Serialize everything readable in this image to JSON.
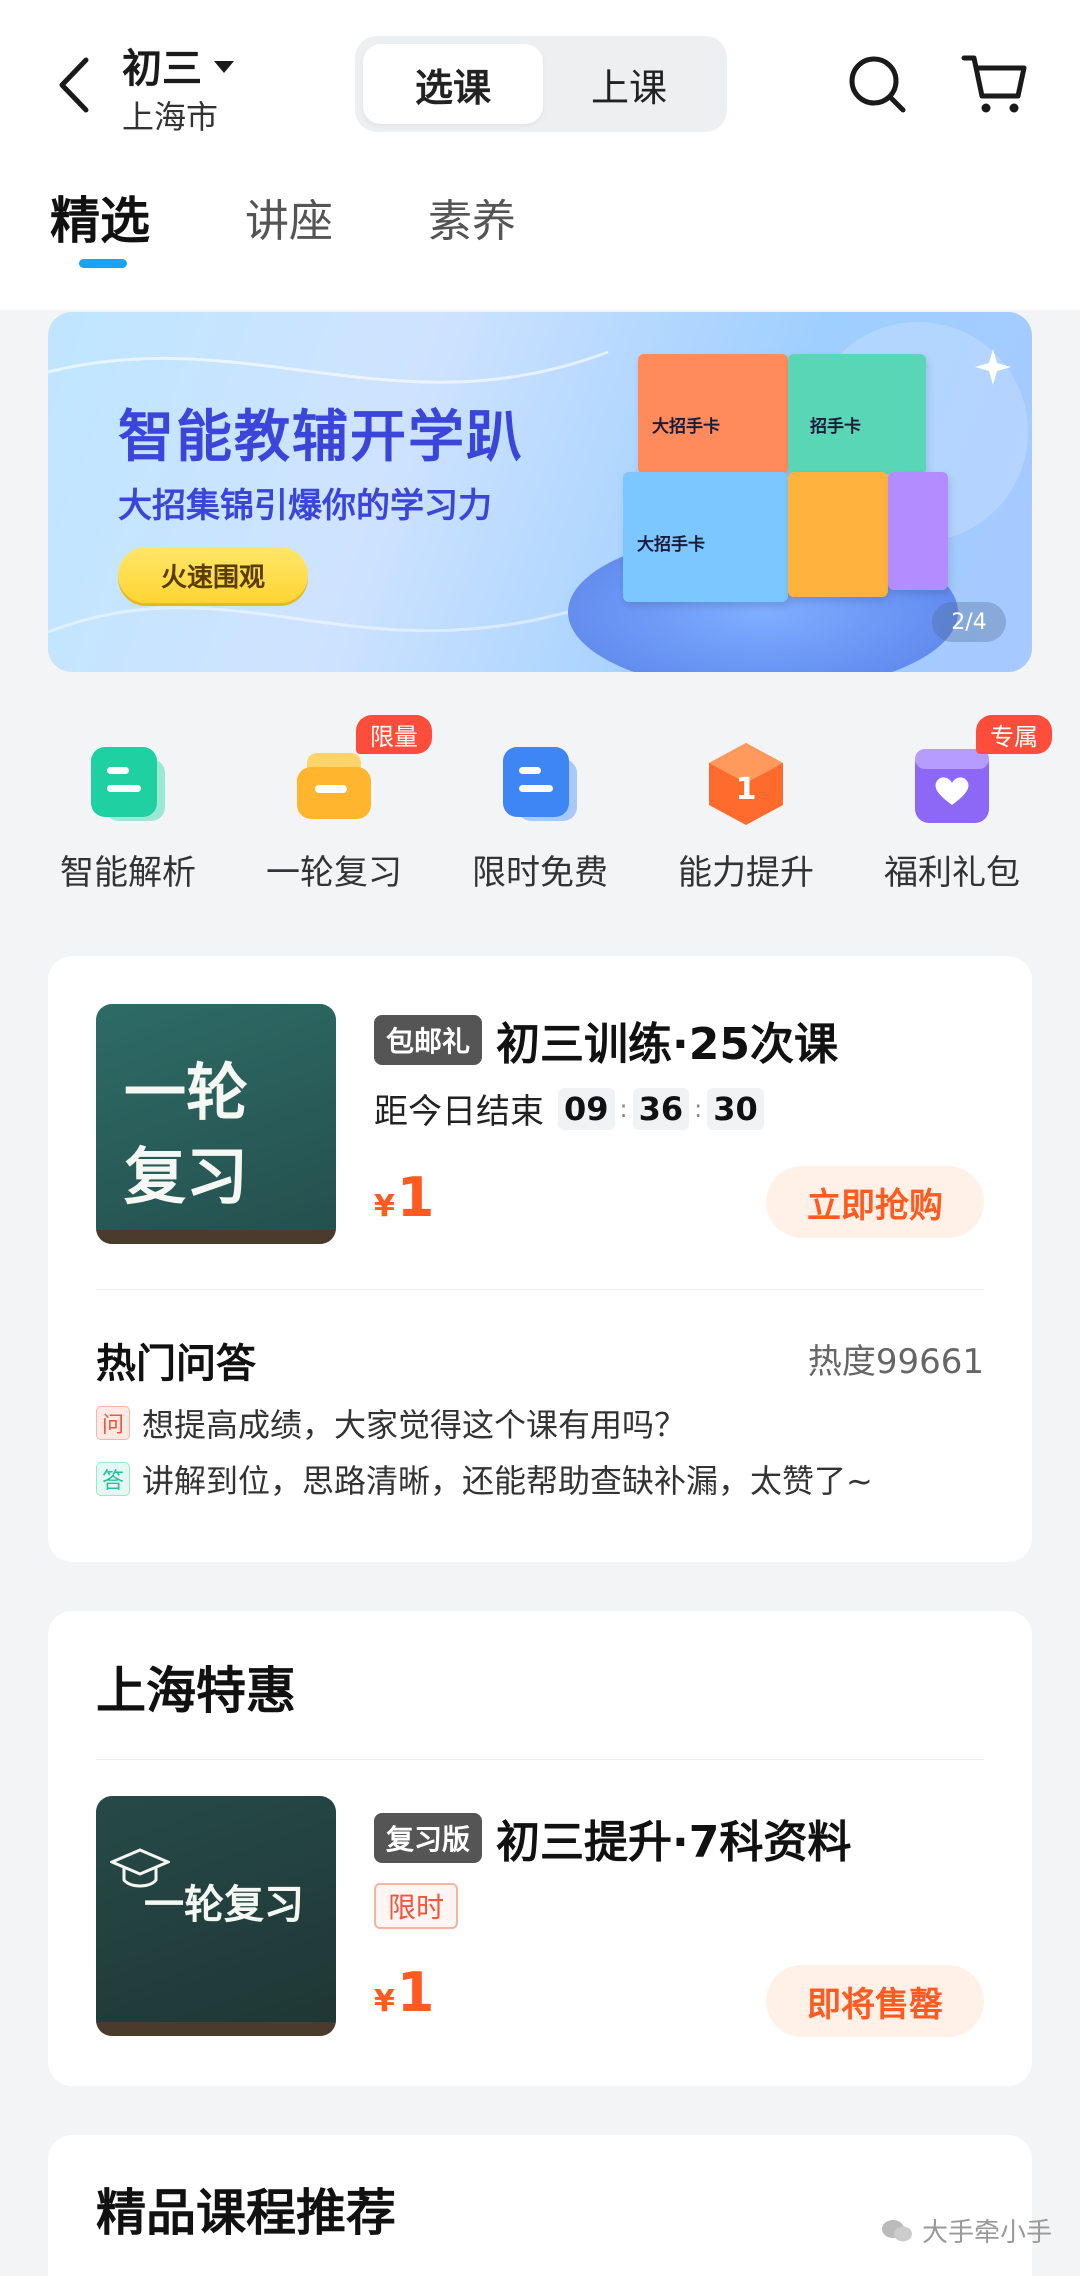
{
  "header": {
    "grade": "初三",
    "city": "上海市",
    "segments": {
      "active": "选课",
      "inactive": "上课"
    }
  },
  "tabs": [
    "精选",
    "讲座",
    "素养"
  ],
  "banner": {
    "title": "智能教辅开学趴",
    "subtitle": "大招集锦引爆你的学习力",
    "button": "火速围观",
    "page_indicator": "2/4",
    "box_labels": [
      "大招手卡",
      "招手卡",
      "大招手卡"
    ]
  },
  "quick_entries": [
    {
      "label": "智能解析",
      "icon": "document-icon",
      "color": "#1fd1a2",
      "badge": ""
    },
    {
      "label": "一轮复习",
      "icon": "folder-icon",
      "color": "#ffb52e",
      "badge": "限量"
    },
    {
      "label": "限时免费",
      "icon": "document-icon",
      "color": "#3f86f5",
      "badge": ""
    },
    {
      "label": "能力提升",
      "icon": "hexagon-one-icon",
      "color": "#ff6b2c",
      "badge": ""
    },
    {
      "label": "福利礼包",
      "icon": "heart-gift-icon",
      "color": "#8d67f6",
      "badge": "专属"
    }
  ],
  "course_card": {
    "thumb_text": [
      "一轮",
      "复习"
    ],
    "tag": "包邮礼",
    "title": "初三训练·25次课",
    "timer_label": "距今日结束",
    "timer": [
      "09",
      "36",
      "30"
    ],
    "currency": "¥",
    "price": "1",
    "cta": "立即抢购",
    "qa_title": "热门问答",
    "qa_heat": "热度99661",
    "question_mark": "问",
    "question": "想提高成绩，大家觉得这个课有用吗？",
    "answer_mark": "答",
    "answer": "讲解到位，思路清晰，还能帮助查缺补漏，太赞了~"
  },
  "shanghai_card": {
    "section_title": "上海特惠",
    "thumb_text": "一轮复习",
    "tag": "复习版",
    "title": "初三提升·7科资料",
    "limited": "限时",
    "currency": "¥",
    "price": "1",
    "cta": "即将售罄"
  },
  "recommend": {
    "section_title": "精品课程推荐"
  },
  "watermark": "大手牵小手",
  "colors": {
    "accent": "#1aa3f5",
    "price": "#ff5a1f",
    "badge": "#ff4d3b"
  }
}
